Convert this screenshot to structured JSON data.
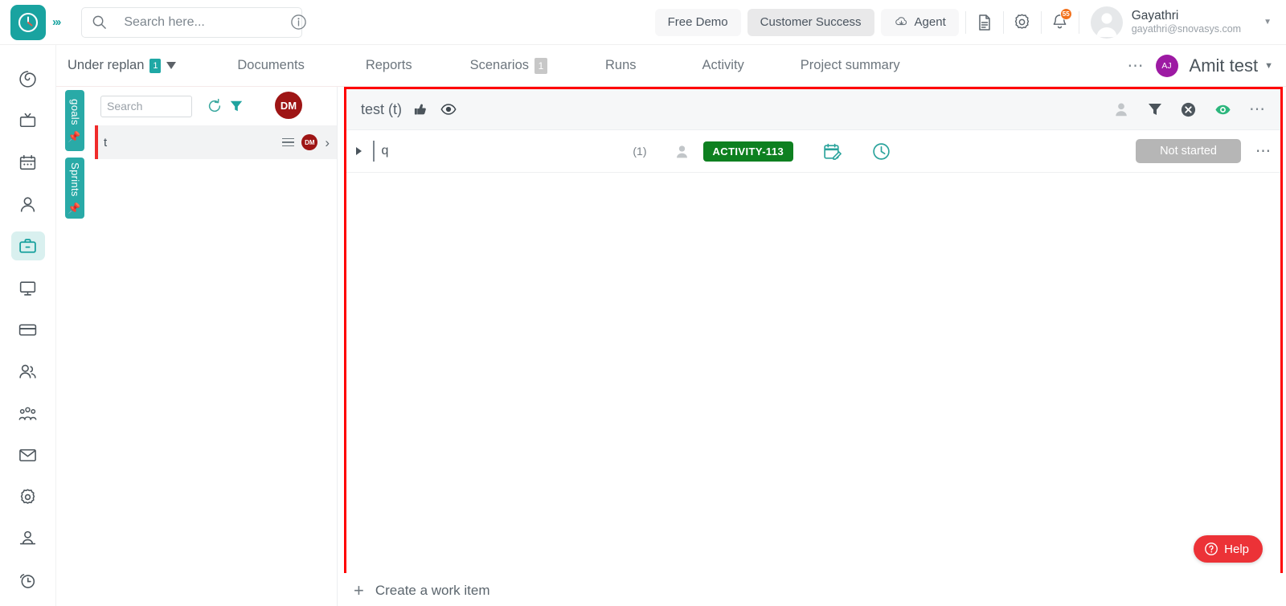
{
  "header": {
    "logo_icon": "clock-logo-icon",
    "expand_icon": "chevrons-right-icon",
    "search": {
      "placeholder": "Search here...",
      "value": "",
      "search_icon": "search-icon",
      "info_icon": "info-circle-icon"
    },
    "pills": [
      {
        "label": "Free Demo",
        "icon": "",
        "active": false
      },
      {
        "label": "Customer Success",
        "icon": "",
        "active": true
      },
      {
        "label": "Agent",
        "icon": "cloud-download-icon",
        "active": false
      }
    ],
    "doc_icon": "document-icon",
    "settings_icon": "gear-icon",
    "bell_icon": "bell-icon",
    "bell_badge": "55",
    "avatar_icon": "avatar-icon",
    "user_name": "Gayathri",
    "user_email": "gayathri@snovasys.com",
    "caret_icon": "chevron-down-icon"
  },
  "nav": {
    "items": [
      {
        "label": "Under replan",
        "badge": "1",
        "badge_type": "teal",
        "caret": true
      },
      {
        "label": "Documents",
        "badge": "",
        "badge_type": "",
        "caret": false
      },
      {
        "label": "Reports",
        "badge": "",
        "badge_type": "",
        "caret": false
      },
      {
        "label": "Scenarios",
        "badge": "1",
        "badge_type": "grey",
        "caret": false
      },
      {
        "label": "Runs",
        "badge": "",
        "badge_type": "",
        "caret": false
      },
      {
        "label": "Activity",
        "badge": "",
        "badge_type": "",
        "caret": false
      },
      {
        "label": "Project summary",
        "badge": "",
        "badge_type": "",
        "caret": false
      }
    ],
    "more_icon": "ellipsis-icon",
    "project_initials": "AJ",
    "project_name": "Amit test",
    "project_caret_icon": "chevron-down-icon"
  },
  "rail": {
    "items": [
      {
        "name": "spiral-icon",
        "active": false
      },
      {
        "name": "tv-icon",
        "active": false
      },
      {
        "name": "calendar-icon",
        "active": false
      },
      {
        "name": "user-icon",
        "active": false
      },
      {
        "name": "briefcase-icon",
        "active": true
      },
      {
        "name": "monitor-icon",
        "active": false
      },
      {
        "name": "card-icon",
        "active": false
      },
      {
        "name": "users-icon",
        "active": false
      },
      {
        "name": "team-icon",
        "active": false
      },
      {
        "name": "mail-icon",
        "active": false
      },
      {
        "name": "gear-icon",
        "active": false
      },
      {
        "name": "person-desk-icon",
        "active": false
      },
      {
        "name": "alarm-clock-icon",
        "active": false
      }
    ]
  },
  "side_tabs": [
    {
      "label": "goals",
      "icon": "pin-icon"
    },
    {
      "label": "Sprints",
      "icon": "pin-icon"
    }
  ],
  "list_panel": {
    "search": {
      "placeholder": "Search",
      "value": ""
    },
    "refresh_icon": "refresh-icon",
    "filter_icon": "filter-icon",
    "avatar_initials": "DM",
    "rows": [
      {
        "title": "t",
        "menu_icon": "hamburger-icon",
        "avatar_initials": "DM",
        "expand_icon": "chevron-right-icon"
      }
    ]
  },
  "board": {
    "title": "test (t)",
    "thumb_icon": "thumbs-up-icon",
    "eye_icon": "eye-icon",
    "header_icons": [
      "person-filled-icon",
      "funnel-icon",
      "clear-filter-icon",
      "watch-eye-icon",
      "ellipsis-icon"
    ],
    "rows": [
      {
        "caret_icon": "caret-right-icon",
        "title": "q",
        "count": "(1)",
        "assignee_icon": "person-filled-icon",
        "activity_tag": "ACTIVITY-113",
        "activity_color": "#0e8020",
        "calendar_icon": "calendar-edit-icon",
        "clock_icon": "clock-icon",
        "status": "Not started",
        "status_color": "#b6b6b6",
        "more_icon": "ellipsis-icon"
      }
    ],
    "help_button": {
      "label": "Help",
      "icon": "question-circle-icon",
      "color": "#ec3237"
    }
  },
  "footer": {
    "create_label": "Create a work item",
    "plus_icon": "plus-icon"
  }
}
